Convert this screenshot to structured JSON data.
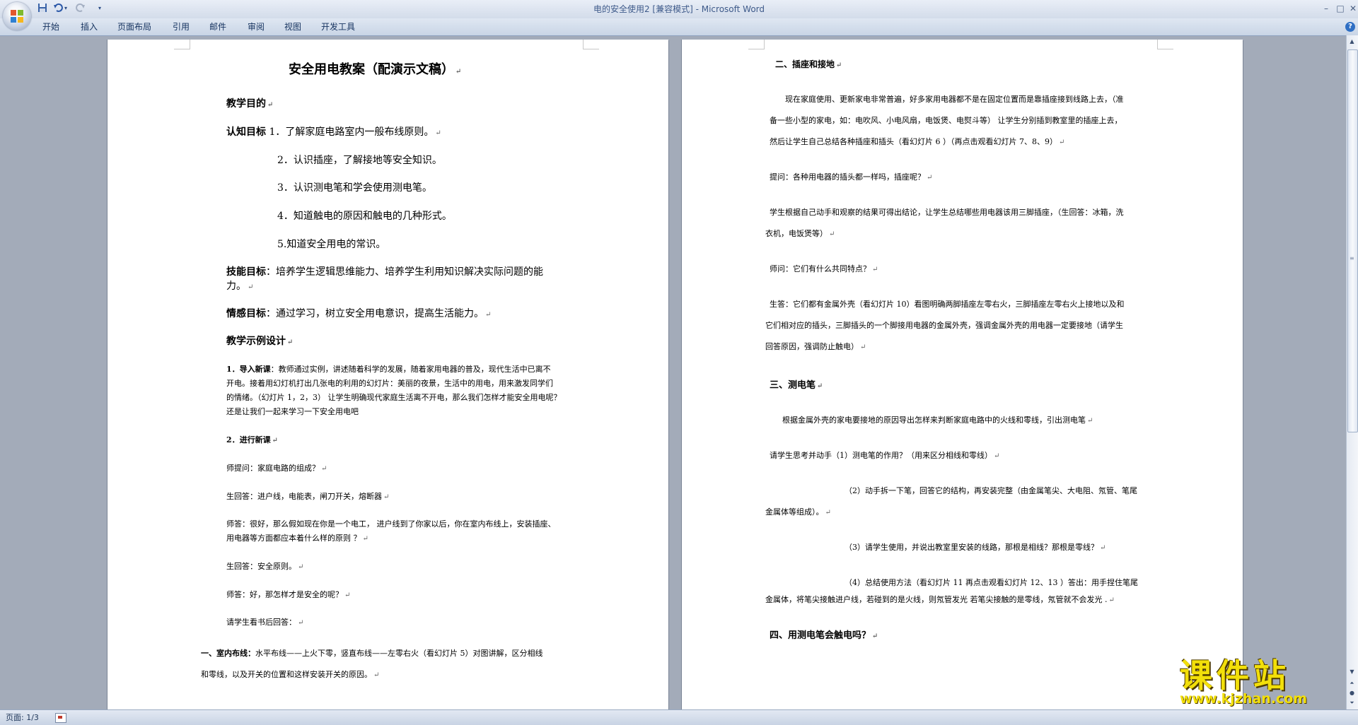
{
  "window": {
    "title": "电的安全使用2 [兼容模式] - Microsoft Word"
  },
  "quick_access": {
    "save_icon": "save-icon",
    "undo_icon": "undo-icon",
    "redo_icon": "redo-icon"
  },
  "ribbon": {
    "tabs": [
      "开始",
      "插入",
      "页面布局",
      "引用",
      "邮件",
      "审阅",
      "视图",
      "开发工具"
    ]
  },
  "left_page": {
    "title": "安全用电教案（配演示文稿）",
    "teaching_goal_heading": "教学目的",
    "cognitive_label": "认知目标",
    "cognitive_items": [
      "1．了解家庭电路室内一般布线原则。",
      "2．认识插座，了解接地等安全知识。",
      "3．认识测电笔和学会使用测电笔。",
      "4．知道触电的原因和触电的几种形式。",
      "5.知道安全用电的常识。"
    ],
    "skill_label": "技能目标",
    "skill_text_1": "：培养学生逻辑思维能力、培养学生利用知识解决实际问题的能",
    "skill_text_2": "力。",
    "emotion_label": "情感目标",
    "emotion_text": "：通过学习，树立安全用电意识，提高生活能力。",
    "design_heading": "教学示例设计",
    "intro_label": "1．导入新课",
    "intro_text_1": "：教师通过实例，讲述随着科学的发展，随着家用电器的普及，现代生活中已离不",
    "intro_text_2": "开电。接着用幻灯机打出几张电的利用的幻灯片：美丽的夜景，生活中的用电，用来激发同学们",
    "intro_text_3": "的情绪。（幻灯片 1，2，3） 让学生明确现代家庭生活离不开电，那么我们怎样才能安全用电呢？",
    "intro_text_4": "还是让我们一起来学习一下安全用电吧",
    "new_lesson_heading": "2．进行新课",
    "q1": "师提问：家庭电路的组成？",
    "a1": "生回答：进户线，电能表，闸刀开关，熔断器",
    "q2_1": "师答：很好，那么假如现在你是一个电工， 进户线到了你家以后，你在室内布线上，安装插座、",
    "q2_2": "用电器等方面都应本着什么样的原则 ？",
    "a2": "生回答：安全原则。",
    "q3": "师答：好，那怎样才是安全的呢？",
    "a3": "请学生看书后回答：",
    "wiring_label": "一、室内布线：",
    "wiring_text_1": "水平布线——上火下零，竖直布线——左零右火（看幻灯片 5）对图讲解，区分相线",
    "wiring_text_2": "和零线，以及开关的位置和这样安装开关的原因。"
  },
  "right_page": {
    "socket_heading": "二、插座和接地",
    "p1_1": "现在家庭使用、更新家电非常普遍，好多家用电器都不是在固定位置而是靠插座接到线路上去，（准",
    "p1_2": "备一些小型的家电，如：电吹风、小电风扇，电饭煲、电熨斗等） 让学生分别插到教室里的插座上去，",
    "p1_3": "然后让学生自己总结各种插座和插头（看幻灯片 6 ）（再点击观看幻灯片 7、8、9）",
    "q_plug": "提问：各种用电器的插头都一样吗，插座呢？",
    "p2_1": "学生根据自己动手和观察的结果可得出结论，让学生总结哪些用电器该用三脚插座，（生回答：冰箱，洗",
    "p2_2": "衣机，电饭煲等）",
    "q_common": "师问：它们有什么共同特点？",
    "p3_1": "生答：它们都有金属外壳（看幻灯片 10）看图明确两脚插座左零右火，三脚插座左零右火上接地以及和",
    "p3_2": "它们相对应的插头，三脚插头的一个脚接用电器的金属外壳，强调金属外壳的用电器一定要接地（请学生",
    "p3_3": "回答原因，强调防止触电）",
    "tester_heading": "三、测电笔",
    "p4": "根据金属外壳的家电要接地的原因导出怎样来判断家庭电路中的火线和零线，引出测电笔",
    "p5": "请学生思考并动手（1）测电笔的作用？（用来区分相线和零线）",
    "p6_1": "（2）动手拆一下笔，回答它的结构，再安装完整（由金属笔尖、大电阻、氖管、笔尾",
    "p6_2": "金属体等组成）。",
    "p7": "（3）请学生使用，并说出教室里安装的线路，那根是相线？那根是零线？",
    "p8_1": "（4）总结使用方法（看幻灯片 11 再点击观看幻灯片 12、13 ）答出：用手捏住笔尾",
    "p8_2": "金属体，将笔尖接触进户线，若碰到的是火线，则氖管发光 若笔尖接触的是零线，氖管就不会发光 .",
    "shock_heading": "四、用测电笔会触电吗？"
  },
  "status_bar": {
    "page_indicator": "页面: 1/3"
  },
  "watermark": {
    "main": "课件站",
    "url": "www.kjzhan.com"
  }
}
